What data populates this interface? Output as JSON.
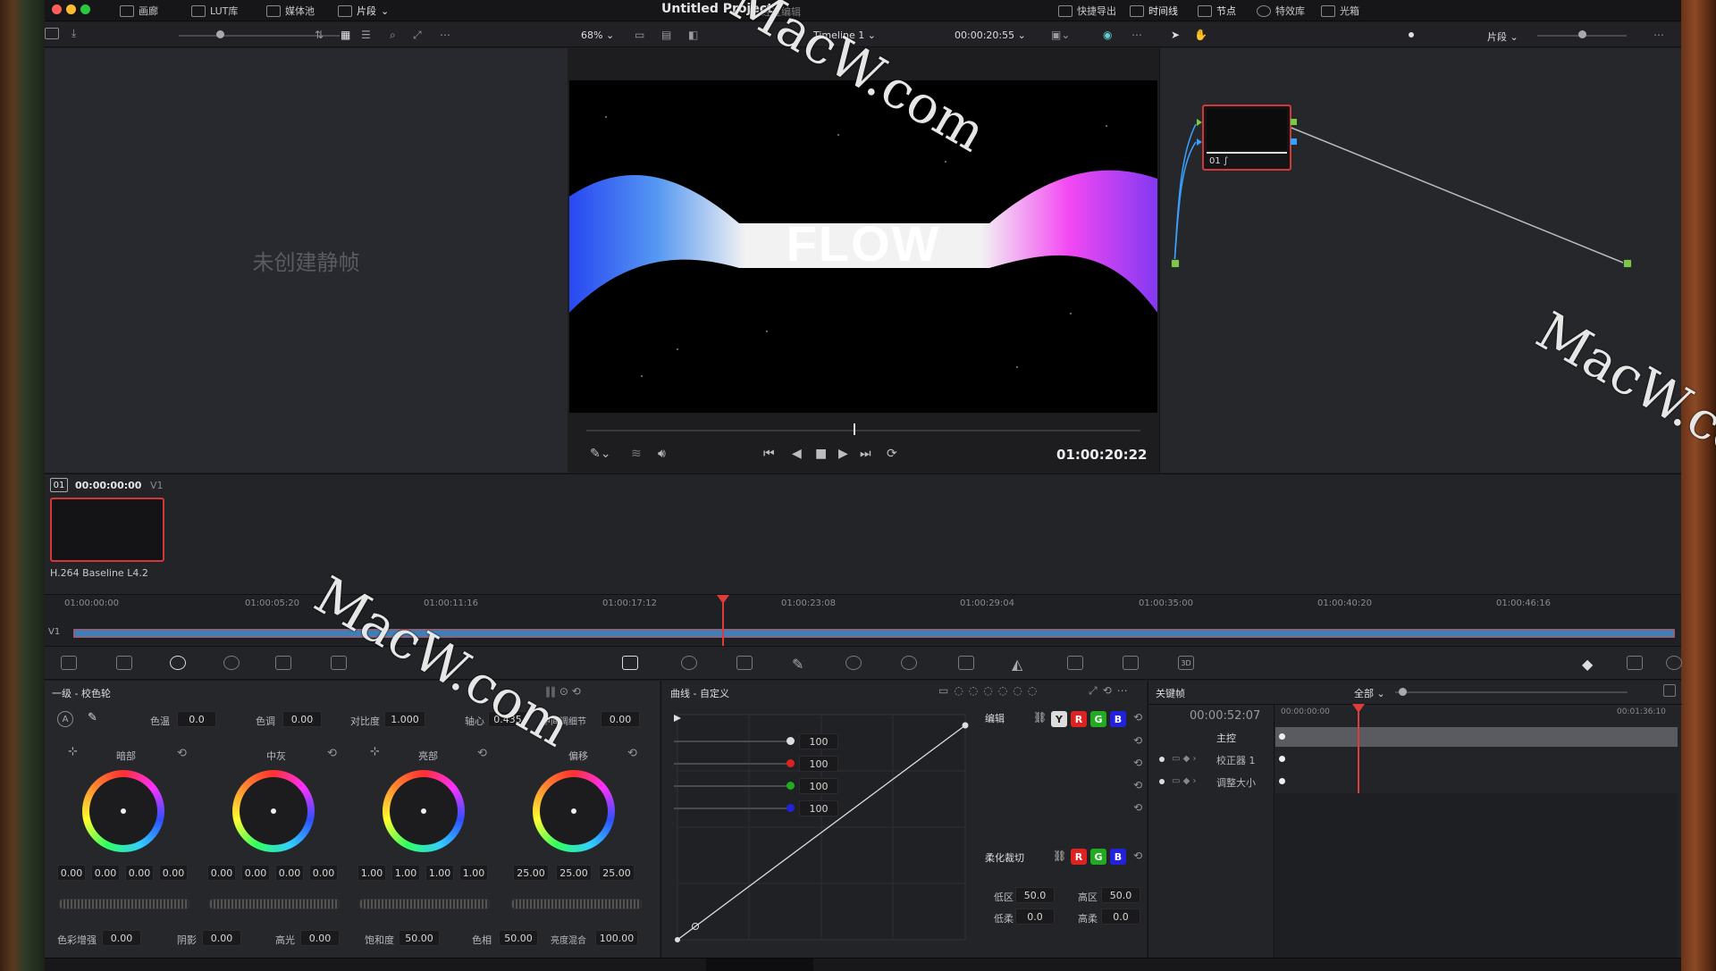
{
  "topbar": {
    "tabs": [
      "画廊",
      "LUT库",
      "媒体池",
      "片段"
    ],
    "project_title": "Untitled Project",
    "edit_status": "经过编辑",
    "right_tabs": [
      "快捷导出",
      "时间线",
      "节点",
      "特效库",
      "光箱"
    ]
  },
  "viewer_toolbar": {
    "zoom": "68%",
    "timeline_name": "Timeline 1",
    "timecode": "00:00:20:55",
    "right_mode": "片段"
  },
  "gallery": {
    "empty_text": "未创建静帧"
  },
  "viewer": {
    "title_text": "FLOW",
    "timecode": "01:00:20:22"
  },
  "nodes": {
    "node_label": "01"
  },
  "clip": {
    "index": "01",
    "timecode": "00:00:00:00",
    "track": "V1",
    "codec": "H.264 Baseline L4.2"
  },
  "timeline": {
    "track": "V1",
    "ticks": [
      "01:00:00:00",
      "01:00:05:20",
      "01:00:11:16",
      "01:00:17:12",
      "01:00:23:08",
      "01:00:29:04",
      "01:00:35:00",
      "01:00:40:20",
      "01:00:46:16"
    ]
  },
  "wheels": {
    "title": "一级 - 校色轮",
    "params_top": [
      {
        "label": "色温",
        "value": "0.0"
      },
      {
        "label": "色调",
        "value": "0.00"
      },
      {
        "label": "对比度",
        "value": "1.000"
      },
      {
        "label": "轴心",
        "value": "0.435"
      },
      {
        "label": "中间调细节",
        "value": "0.00"
      }
    ],
    "items": [
      {
        "name": "暗部",
        "values": [
          "0.00",
          "0.00",
          "0.00",
          "0.00"
        ]
      },
      {
        "name": "中灰",
        "values": [
          "0.00",
          "0.00",
          "0.00",
          "0.00"
        ]
      },
      {
        "name": "亮部",
        "values": [
          "1.00",
          "1.00",
          "1.00",
          "1.00"
        ]
      },
      {
        "name": "偏移",
        "values": [
          "25.00",
          "25.00",
          "25.00"
        ]
      }
    ],
    "params_bottom": [
      {
        "label": "色彩增强",
        "value": "0.00"
      },
      {
        "label": "阴影",
        "value": "0.00"
      },
      {
        "label": "高光",
        "value": "0.00"
      },
      {
        "label": "饱和度",
        "value": "50.00"
      },
      {
        "label": "色相",
        "value": "50.00"
      },
      {
        "label": "亮度混合",
        "value": "100.00"
      }
    ]
  },
  "curves": {
    "title": "曲线 - 自定义",
    "edit_label": "编辑",
    "channels": [
      "Y",
      "R",
      "G",
      "B"
    ],
    "channel_values": [
      "100",
      "100",
      "100",
      "100"
    ],
    "soft_clip_label": "柔化裁切",
    "soft_channels": [
      "R",
      "G",
      "B"
    ],
    "low_label": "低区",
    "low_value": "50.0",
    "high_label": "高区",
    "high_value": "50.0",
    "low_soft_label": "低柔",
    "low_soft_value": "0.0",
    "high_soft_label": "高柔",
    "high_soft_value": "0.0"
  },
  "keyframes": {
    "title": "关键帧",
    "filter": "全部",
    "timecode": "00:00:52:07",
    "start": "00:00:00:00",
    "end": "00:01:36:10",
    "rows": [
      "主控",
      "校正器 1",
      "调整大小"
    ]
  },
  "watermark": "MacW.com",
  "colors": {
    "accent": "#e03b3b",
    "playhead": "#e03b3b",
    "node_border": "#d0383a"
  }
}
